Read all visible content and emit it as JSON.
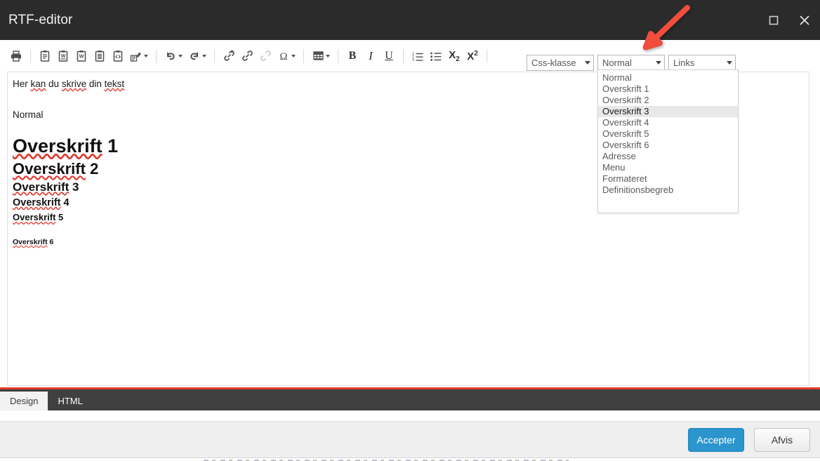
{
  "window": {
    "title": "RTF-editor",
    "controls": [
      {
        "name": "maximize",
        "icon": "maximize-icon"
      },
      {
        "name": "close",
        "icon": "close-icon"
      }
    ]
  },
  "toolbar": {
    "groups": [
      {
        "name": "print-group",
        "buttons": [
          {
            "id": "print",
            "icon": "printer-icon",
            "title": "Udskriv",
            "disabled": false,
            "caret": false
          }
        ]
      },
      {
        "name": "clipboard-group",
        "buttons": [
          {
            "id": "paste",
            "icon": "paste-icon",
            "title": "Sæt ind",
            "disabled": false,
            "caret": false
          },
          {
            "id": "paste-from-word",
            "icon": "paste-word-icon",
            "title": "Sæt ind fra Word",
            "disabled": false,
            "caret": false
          },
          {
            "id": "paste-from-word-clean",
            "icon": "paste-word-clean-icon",
            "title": "Sæt ind fra Word uden formatering",
            "disabled": false,
            "caret": false
          },
          {
            "id": "paste-as-text",
            "icon": "paste-text-icon",
            "title": "Sæt ind som tekst",
            "disabled": false,
            "caret": false
          },
          {
            "id": "paste-html",
            "icon": "paste-code-icon",
            "title": "Sæt ind som HTML",
            "disabled": false,
            "caret": false
          },
          {
            "id": "format-painter",
            "icon": "format-painter-icon",
            "title": "Formatpensel",
            "disabled": false,
            "caret": true
          }
        ]
      },
      {
        "name": "history-group",
        "buttons": [
          {
            "id": "undo",
            "icon": "undo-icon",
            "title": "Fortryd",
            "disabled": false,
            "caret": true
          },
          {
            "id": "redo",
            "icon": "redo-icon",
            "title": "Gentag",
            "disabled": false,
            "caret": true
          }
        ]
      },
      {
        "name": "insert-group",
        "buttons": [
          {
            "id": "insert-link",
            "icon": "link-add-icon",
            "title": "Indsæt link",
            "disabled": false,
            "caret": false
          },
          {
            "id": "edit-link",
            "icon": "link-edit-icon",
            "title": "Rediger link",
            "disabled": false,
            "caret": false
          },
          {
            "id": "remove-link",
            "icon": "link-remove-icon",
            "title": "Fjern link",
            "disabled": true,
            "caret": false
          },
          {
            "id": "special-character",
            "icon": "omega-icon",
            "title": "Specialtegn",
            "disabled": false,
            "caret": true
          },
          {
            "id": "table",
            "icon": "table-icon",
            "title": "Tabel",
            "disabled": false,
            "caret": true
          }
        ]
      },
      {
        "name": "format-group",
        "buttons": [
          {
            "id": "bold",
            "icon": "bold-icon",
            "title": "Fed",
            "glyph": "B",
            "disabled": false,
            "caret": false
          },
          {
            "id": "italic",
            "icon": "italic-icon",
            "title": "Kursiv",
            "glyph": "I",
            "disabled": false,
            "caret": false
          },
          {
            "id": "underline",
            "icon": "underline-icon",
            "title": "Understreget",
            "glyph": "U",
            "disabled": false,
            "caret": false
          },
          {
            "id": "ordered-list",
            "icon": "numbered-list-icon",
            "title": "Nummereret liste",
            "disabled": false,
            "caret": false
          },
          {
            "id": "unordered-list",
            "icon": "bulleted-list-icon",
            "title": "Punktopstilling",
            "disabled": false,
            "caret": false
          },
          {
            "id": "subscript",
            "icon": "subscript-icon",
            "title": "Sænket skrift",
            "disabled": false,
            "caret": false
          },
          {
            "id": "superscript",
            "icon": "superscript-icon",
            "title": "Hævet skrift",
            "disabled": false,
            "caret": false
          }
        ]
      }
    ],
    "selects": [
      {
        "id": "css-class",
        "value": "Css-klasse",
        "open": false
      },
      {
        "id": "paragraph-style",
        "value": "Normal",
        "open": true
      },
      {
        "id": "alignment",
        "value": "Links",
        "open": false
      }
    ]
  },
  "style_dropdown": {
    "open": true,
    "highlighted": "Overskrift 3",
    "options": [
      "Normal",
      "Overskrift 1",
      "Overskrift 2",
      "Overskrift 3",
      "Overskrift 4",
      "Overskrift 5",
      "Overskrift 6",
      "Adresse",
      "Menu",
      "Formateret",
      "Definitionsbegreb"
    ]
  },
  "editor": {
    "intro": {
      "w1": "Her ",
      "w2": "kan",
      "w3": " du ",
      "w4": "skrive",
      "w5": " din ",
      "w6": "tekst"
    },
    "normal_line": "Normal",
    "headings": [
      {
        "word": "Overskrift",
        "num": " 1"
      },
      {
        "word": "Overskrift",
        "num": " 2"
      },
      {
        "word": "Overskrift",
        "num": " 3"
      },
      {
        "word": "Overskrift",
        "num": " 4"
      },
      {
        "word": "Overskrift",
        "num": " 5"
      },
      {
        "word": "Overskrift",
        "num": " 6"
      }
    ]
  },
  "tabs": [
    {
      "id": "design",
      "label": "Design",
      "active": true
    },
    {
      "id": "html",
      "label": "HTML",
      "active": false
    }
  ],
  "footer": {
    "accept_label": "Accepter",
    "reject_label": "Afvis"
  },
  "annotation": {
    "type": "arrow",
    "color": "#f04e3e",
    "points_to": "paragraph-style-select"
  },
  "colors": {
    "titlebar": "#2b2b2b",
    "tabbar": "#404040",
    "tab_accent": "#e03a2f",
    "accept_button": "#2b95cd",
    "spellcheck_underline": "#e03a30",
    "annotation_arrow": "#f04e3e"
  }
}
